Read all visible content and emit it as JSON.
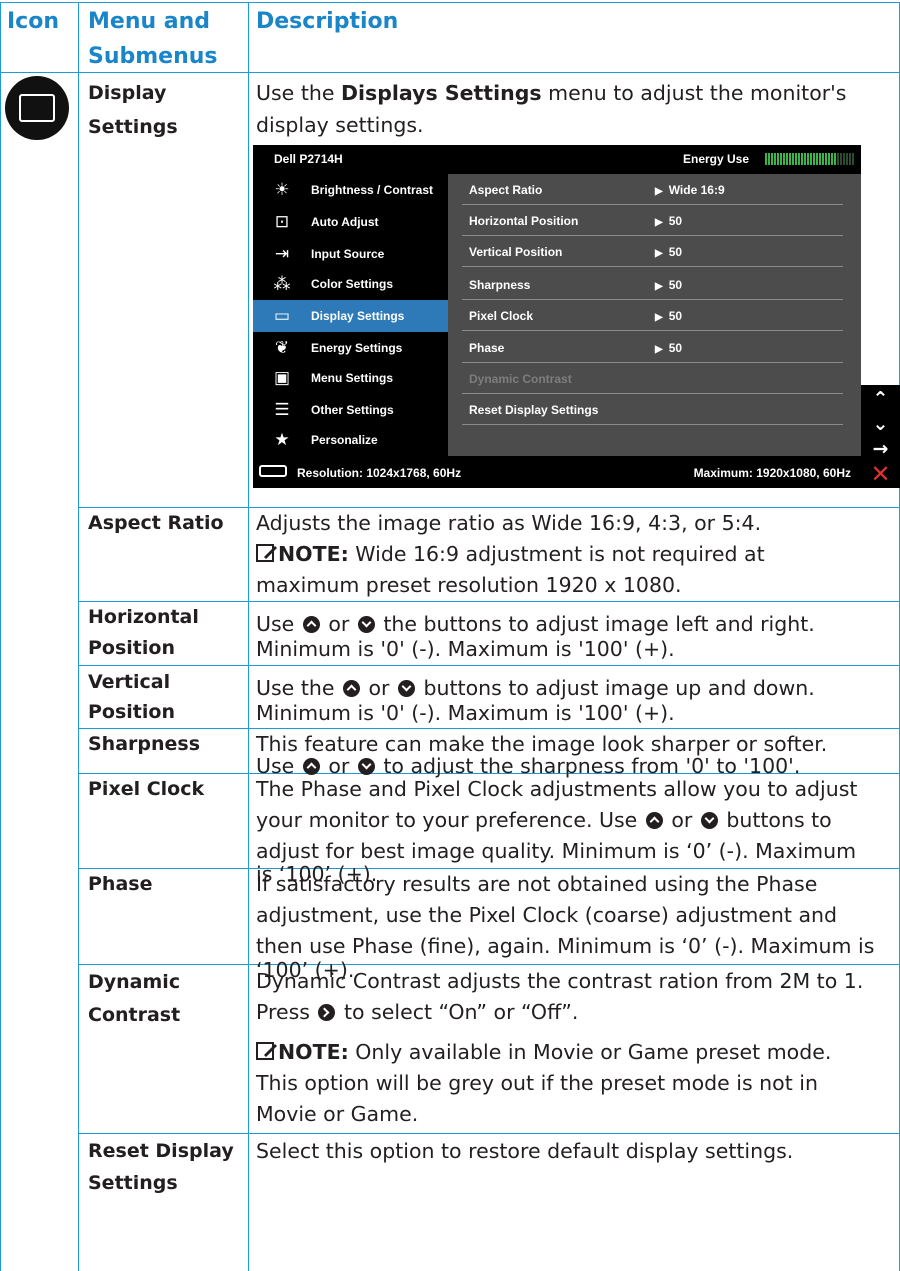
{
  "header": {
    "col_icon": "Icon",
    "col_menu_line1": "Menu and",
    "col_menu_line2": "Submenus",
    "col_desc": "Description"
  },
  "section": {
    "icon": "display-settings-icon",
    "title_line1": "Display",
    "title_line2": "Settings",
    "intro_before": "Use the ",
    "intro_bold": "Displays Settings",
    "intro_after": " menu to adjust the monitor's",
    "intro_line2": "display settings."
  },
  "osd": {
    "model": "Dell P2714H",
    "energy_label": "Energy Use",
    "energy_level": 0.8,
    "left_menu": [
      {
        "icon": "brightness-icon",
        "label": "Brightness / Contrast"
      },
      {
        "icon": "auto-adjust-icon",
        "label": "Auto Adjust"
      },
      {
        "icon": "input-source-icon",
        "label": "Input Source"
      },
      {
        "icon": "color-settings-icon",
        "label": "Color Settings"
      },
      {
        "icon": "display-settings-icon",
        "label": "Display Settings",
        "selected": true
      },
      {
        "icon": "energy-settings-icon",
        "label": "Energy Settings"
      },
      {
        "icon": "menu-settings-icon",
        "label": "Menu Settings"
      },
      {
        "icon": "other-settings-icon",
        "label": "Other Settings"
      },
      {
        "icon": "personalize-icon",
        "label": "Personalize"
      }
    ],
    "submenu": [
      {
        "label": "Aspect Ratio",
        "value": "Wide 16:9"
      },
      {
        "label": "Horizontal Position",
        "value": "50"
      },
      {
        "label": "Vertical Position",
        "value": "50"
      },
      {
        "label": "Sharpness",
        "value": "50"
      },
      {
        "label": "Pixel Clock",
        "value": "50"
      },
      {
        "label": "Phase",
        "value": "50"
      },
      {
        "label": "Dynamic Contrast",
        "value": "",
        "disabled": true
      },
      {
        "label": "Reset Display Settings",
        "value": ""
      }
    ],
    "resolution": "Resolution: 1024x1768, 60Hz",
    "maximum": "Maximum: 1920x1080, 60Hz",
    "nav_buttons": [
      "up-arrow-icon",
      "down-arrow-icon",
      "right-arrow-icon",
      "close-icon"
    ]
  },
  "rows": {
    "aspect": {
      "name": "Aspect Ratio",
      "line1": "Adjusts the image ratio as Wide 16:9, 4:3, or 5:4.",
      "note_label": "NOTE:",
      "note_line1": " Wide 16:9 adjustment is not required at",
      "note_line2": "maximum preset resolution 1920 x 1080."
    },
    "hpos": {
      "name_line1": "Horizontal",
      "name_line2": "Position",
      "line1_a": "Use ",
      "line1_b": " or ",
      "line1_c": " the buttons to adjust image left and right.",
      "line2": "Minimum is '0' (-). Maximum is '100' (+)."
    },
    "vpos": {
      "name_line1": "Vertical",
      "name_line2": "Position",
      "line1_a": "Use the ",
      "line1_b": " or ",
      "line1_c": " buttons to adjust image up and down.",
      "line2": "Minimum is '0' (-). Maximum is '100' (+)."
    },
    "sharpness": {
      "name": "Sharpness",
      "line1": "This feature can make the image look sharper or softer.",
      "line2_a": "Use  ",
      "line2_b": " or ",
      "line2_c": " to adjust the sharpness from '0' to '100'."
    },
    "pixelclock": {
      "name": "Pixel Clock",
      "line1": "The Phase and Pixel Clock adjustments allow you to adjust",
      "line2_a": "your monitor to your preference. Use ",
      "line2_b": " or ",
      "line2_c": " buttons to",
      "line3": "adjust for best image quality. Minimum is ‘0’ (-). Maximum",
      "line4": "is ‘100’ (+)."
    },
    "phase": {
      "name": "Phase",
      "line1": "If satisfactory results are not obtained using the Phase",
      "line2": "adjustment, use the Pixel Clock (coarse) adjustment and",
      "line3": "then use Phase (fine), again. Minimum is ‘0’ (-). Maximum is",
      "line4": "‘100’ (+)."
    },
    "dyncontrast": {
      "name_line1": "Dynamic",
      "name_line2": "Contrast",
      "line1": "Dynamic Contrast adjusts the contrast ration from 2M to 1.",
      "line2_a": "Press ",
      "line2_b": " to select “On” or “Off”.",
      "note_label": "NOTE:",
      "note_line1": " Only available in Movie or Game preset mode.",
      "note_line2": "This option will be grey out if the preset mode is not in",
      "note_line3": "Movie or Game."
    },
    "reset": {
      "name_line1": "Reset Display",
      "name_line2": "Settings",
      "line1": "Select this option to restore default display settings."
    }
  }
}
